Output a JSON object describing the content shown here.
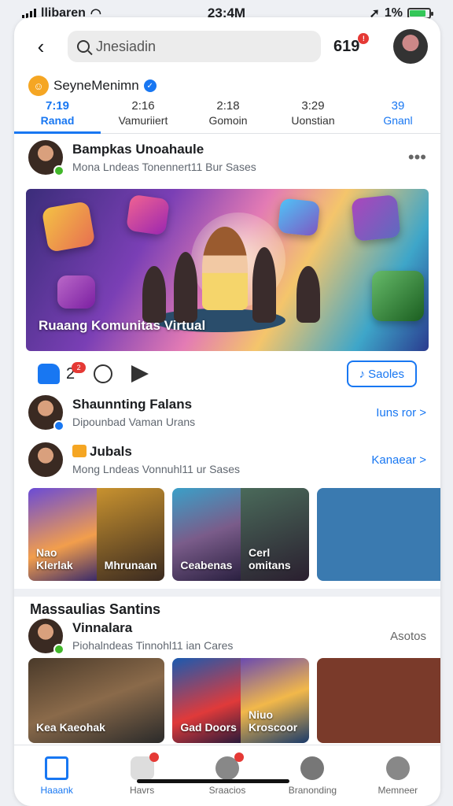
{
  "statusbar": {
    "carrier": "llibaren",
    "time": "23:4M",
    "battery": "1%"
  },
  "topbar": {
    "search_placeholder": "Jnesiadin",
    "notif_count": "619"
  },
  "page": {
    "name": "SeyneMenimn"
  },
  "tabs": [
    {
      "num": "7:19",
      "label": "Ranad"
    },
    {
      "num": "2:16",
      "label": "Vamuriiert"
    },
    {
      "num": "2:18",
      "label": "Gomoin"
    },
    {
      "num": "3:29",
      "label": "Uonstian"
    },
    {
      "num": "39",
      "label": "Gnanl"
    }
  ],
  "post": {
    "author": "Bampkas Unoahaule",
    "meta": "Mona Lndeas  Tonennert11 Bur Sases",
    "image_caption": "Ruaang Komunitas Virtual",
    "like_count": "2",
    "like_badge": "2",
    "save_label": "Saoles"
  },
  "row1": {
    "title": "Shaunnting Falans",
    "sub": "Dipounbad  Vaman Urans",
    "link": "Iuns ror >"
  },
  "row2": {
    "title": "Jubals",
    "sub": "Mong Lndeas  Vonnuhl11 ur Sases",
    "link": "Kanaear >"
  },
  "thumbs1": [
    {
      "a": "Nao Klerlak",
      "b": "Mhrunaan"
    },
    {
      "a": "Ceabenas",
      "b": "Cerl omitans"
    }
  ],
  "section": {
    "title": "Massaulias Santins"
  },
  "row3": {
    "title": "Vinnalara",
    "sub": "Piohalndeas  Tinnohl11 ian Cares",
    "link": "Asotos"
  },
  "thumbs2": [
    {
      "a": "Kea Kaeohak",
      "b": ""
    },
    {
      "a": "Gad Doors",
      "b": "Niuo Kroscoor"
    }
  ],
  "nav": [
    {
      "label": "Haaank",
      "icon": "home-icon"
    },
    {
      "label": "Havrs",
      "icon": "groups-icon"
    },
    {
      "label": "Sraacios",
      "icon": "services-icon"
    },
    {
      "label": "Branonding",
      "icon": "trending-icon"
    },
    {
      "label": "Memneer",
      "icon": "member-icon"
    }
  ],
  "colors": {
    "accent": "#1877f2",
    "badge": "#e53935"
  }
}
